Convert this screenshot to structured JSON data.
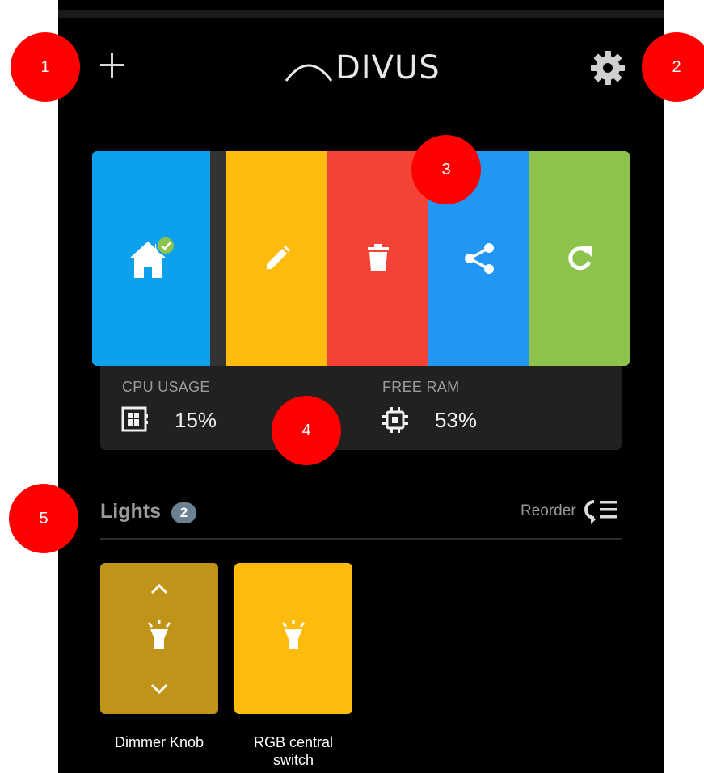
{
  "header": {
    "logo_text": "DIVUS"
  },
  "dashboard": {
    "tiles": [
      {
        "action": "home",
        "icon": "home-check-icon",
        "color": "#0da0ec"
      },
      {
        "action": "edit",
        "icon": "pencil-icon",
        "color": "#fdbc0d"
      },
      {
        "action": "delete",
        "icon": "trash-icon",
        "color": "#f44236"
      },
      {
        "action": "share",
        "icon": "share-icon",
        "color": "#2196f3"
      },
      {
        "action": "refresh",
        "icon": "refresh-icon",
        "color": "#8bc34b"
      }
    ]
  },
  "stats": {
    "cpu": {
      "label": "CPU USAGE",
      "value": "15%",
      "icon": "cpu-grid-icon"
    },
    "ram": {
      "label": "FREE RAM",
      "value": "53%",
      "icon": "chip-icon"
    }
  },
  "section": {
    "title": "Lights",
    "count": "2",
    "reorder_label": "Reorder"
  },
  "devices": [
    {
      "label": "Dimmer Knob",
      "icon": "lightbulb-icon",
      "color": "#c09418"
    },
    {
      "label_line1": "RGB central",
      "label_line2": "switch",
      "icon": "lightbulb-icon",
      "color": "#fdbc0d"
    }
  ],
  "callouts": [
    "1",
    "2",
    "3",
    "4",
    "5"
  ],
  "colors": {
    "background": "#000000",
    "panel": "#212121",
    "accent_red": "#ff0000"
  }
}
